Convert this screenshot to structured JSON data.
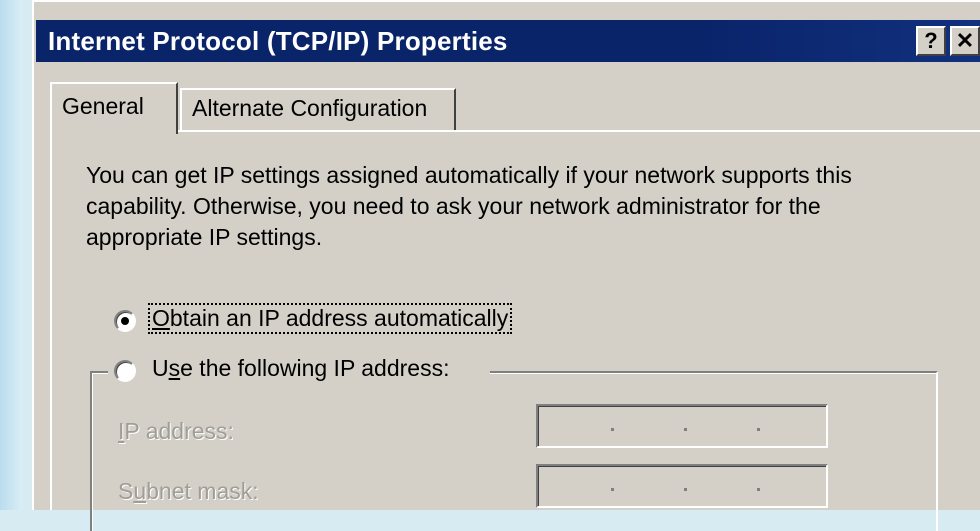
{
  "dialog": {
    "title": "Internet Protocol (TCP/IP) Properties",
    "help_button": "?",
    "close_button": "✕"
  },
  "tabs": [
    {
      "label": "General",
      "selected": true
    },
    {
      "label": "Alternate Configuration",
      "selected": false
    }
  ],
  "description": "You can get IP settings assigned automatically if your network supports this capability. Otherwise, you need to ask your network administrator for the appropriate IP settings.",
  "options": {
    "obtain_auto": {
      "first": "O",
      "rest": "btain an IP address automatically",
      "selected": true
    },
    "use_following": {
      "first": "U",
      "underlined": "s",
      "rest": "e the following IP address:",
      "selected": false
    }
  },
  "fields": {
    "ip_address": {
      "underlined": "I",
      "rest": "P address:",
      "value": ". . ."
    },
    "subnet_mask": {
      "first": "S",
      "underlined": "u",
      "rest": "bnet mask:",
      "value": ". . ."
    }
  },
  "icons": {
    "help": "help-icon",
    "close": "close-icon"
  },
  "colors": {
    "titlebar": "#0a246a",
    "face": "#d4d0c8",
    "disabled_text": "#a09d96"
  }
}
